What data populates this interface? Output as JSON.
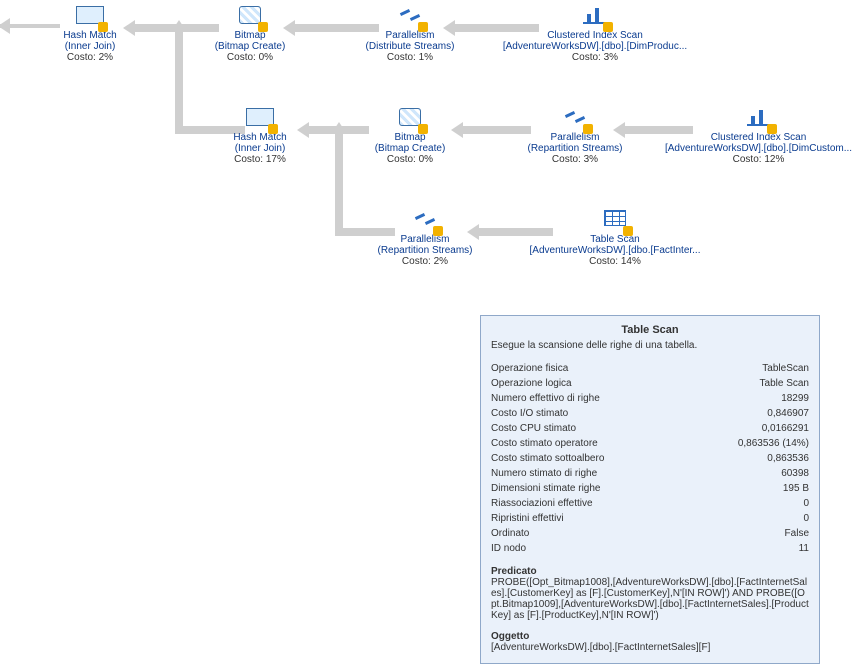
{
  "row1": {
    "n1": {
      "title": "Hash Match",
      "sub": "(Inner Join)",
      "cost": "Costo: 2%"
    },
    "n2": {
      "title": "Bitmap",
      "sub": "(Bitmap Create)",
      "cost": "Costo: 0%"
    },
    "n3": {
      "title": "Parallelism",
      "sub": "(Distribute Streams)",
      "cost": "Costo: 1%"
    },
    "n4": {
      "title": "Clustered Index Scan",
      "sub": "[AdventureWorksDW].[dbo].[DimProduc...",
      "cost": "Costo: 3%"
    }
  },
  "row2": {
    "n1": {
      "title": "Hash Match",
      "sub": "(Inner Join)",
      "cost": "Costo: 17%"
    },
    "n2": {
      "title": "Bitmap",
      "sub": "(Bitmap Create)",
      "cost": "Costo: 0%"
    },
    "n3": {
      "title": "Parallelism",
      "sub": "(Repartition Streams)",
      "cost": "Costo: 3%"
    },
    "n4": {
      "title": "Clustered Index Scan",
      "sub": "[AdventureWorksDW].[dbo].[DimCustom...",
      "cost": "Costo: 12%"
    }
  },
  "row3": {
    "n1": {
      "title": "Parallelism",
      "sub": "(Repartition Streams)",
      "cost": "Costo: 2%"
    },
    "n2": {
      "title": "Table Scan",
      "sub": "[AdventureWorksDW].[dbo.[FactInter...",
      "cost": "Costo: 14%"
    }
  },
  "tooltip": {
    "title": "Table Scan",
    "desc": "Esegue la scansione delle righe di una tabella.",
    "rows": [
      {
        "l": "Operazione fisica",
        "v": "TableScan"
      },
      {
        "l": "Operazione logica",
        "v": "Table Scan"
      },
      {
        "l": "Numero effettivo di righe",
        "v": "18299"
      },
      {
        "l": "Costo I/O stimato",
        "v": "0,846907"
      },
      {
        "l": "Costo CPU stimato",
        "v": "0,0166291"
      },
      {
        "l": "Costo stimato operatore",
        "v": "0,863536 (14%)"
      },
      {
        "l": "Costo stimato sottoalbero",
        "v": "0,863536"
      },
      {
        "l": "Numero stimato di righe",
        "v": "60398"
      },
      {
        "l": "Dimensioni stimate righe",
        "v": "195 B"
      },
      {
        "l": "Riassociazioni effettive",
        "v": "0"
      },
      {
        "l": "Ripristini effettivi",
        "v": "0"
      },
      {
        "l": "Ordinato",
        "v": "False"
      },
      {
        "l": "ID nodo",
        "v": "11"
      }
    ],
    "predicate_label": "Predicato",
    "predicate_text": "PROBE([Opt_Bitmap1008],[AdventureWorksDW].[dbo].[FactInternetSales].[CustomerKey] as [F].[CustomerKey],N'[IN ROW]') AND PROBE([Opt.Bitmap1009],[AdventureWorksDW].[dbo].[FactInternetSales].[ProductKey] as [F].[ProductKey],N'[IN ROW]')",
    "object_label": "Oggetto",
    "object_text": "[AdventureWorksDW].[dbo].[FactInternetSales][F]"
  }
}
